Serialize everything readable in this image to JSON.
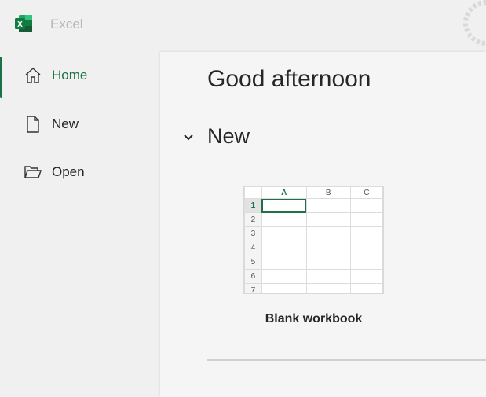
{
  "app": {
    "title": "Excel",
    "brand_color": "#1e7145",
    "logo_letter": "X"
  },
  "sidebar": {
    "items": [
      {
        "label": "Home",
        "icon": "home-icon",
        "active": true
      },
      {
        "label": "New",
        "icon": "new-document-icon",
        "active": false
      },
      {
        "label": "Open",
        "icon": "open-folder-icon",
        "active": false
      }
    ]
  },
  "main": {
    "greeting": "Good afternoon",
    "section_title": "New",
    "templates": [
      {
        "label": "Blank workbook",
        "columns": [
          "A",
          "B",
          "C"
        ],
        "rows": [
          "1",
          "2",
          "3",
          "4",
          "5",
          "6",
          "7"
        ]
      }
    ]
  }
}
